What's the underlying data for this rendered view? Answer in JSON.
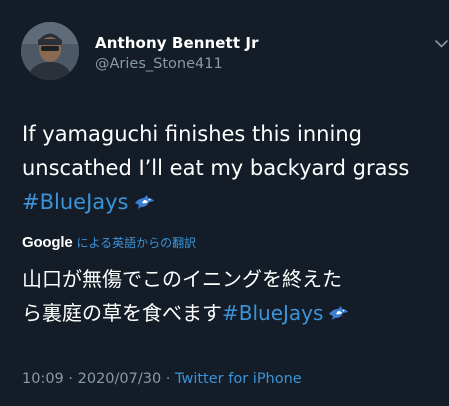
{
  "author": {
    "name": "Anthony Bennett Jr",
    "handle": "@Aries_Stone411"
  },
  "tweet": {
    "line1": "If yamaguchi finishes this inning",
    "line2": "unscathed I’ll eat my backyard grass",
    "hashtag": "#BlueJays"
  },
  "translation": {
    "provider": "Google",
    "label": "による英語からの翻訳",
    "line1": "山口が無傷でこのイニングを終えた",
    "line2_text": "ら裏庭の草を食べます",
    "hashtag": "#BlueJays"
  },
  "meta": {
    "time": "10:09",
    "separator1": " · ",
    "date": "2020/07/30",
    "separator2": " · ",
    "source": "Twitter for iPhone"
  },
  "icons": {
    "menu": "chevron-down-icon",
    "hashtag_emoji": "blue-jays-logo-icon"
  },
  "colors": {
    "background": "#141d27",
    "link": "#3b94d9",
    "secondary_text": "#8899a6",
    "primary_text": "#ffffff"
  }
}
